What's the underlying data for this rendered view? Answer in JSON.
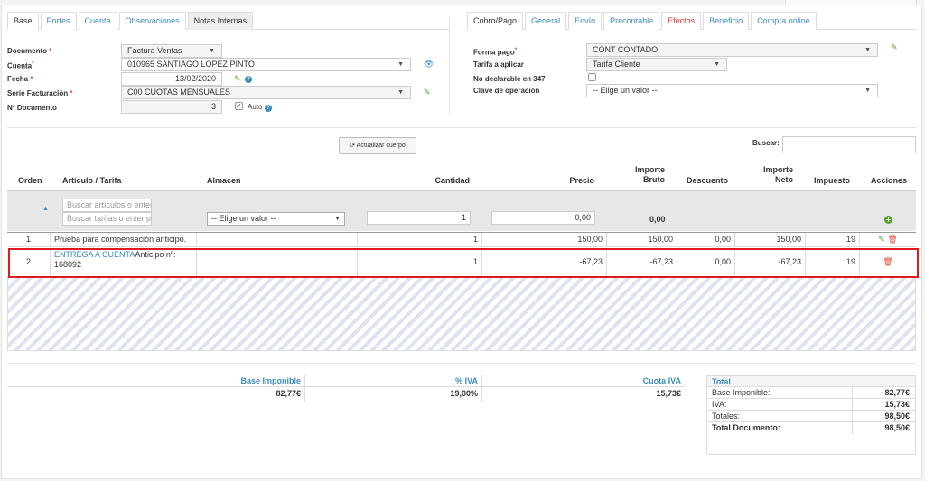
{
  "left_tabs": [
    "Base",
    "Portes",
    "Cuenta",
    "Observaciones",
    "Notas Internas"
  ],
  "right_tabs": [
    "Cobro/Pago",
    "General",
    "Envío",
    "Precontable",
    "Efectos",
    "Beneficio",
    "Compra online"
  ],
  "form_left": {
    "documento_label": "Documento",
    "documento_value": "Factura Ventas",
    "cuenta_label": "Cuenta",
    "cuenta_value": "010965 SANTIAGO LOPEZ PINTO",
    "fecha_label": "Fecha",
    "fecha_value": "13/02/2020",
    "serie_label": "Serie Facturación",
    "serie_value": "C00 CUOTAS MENSUALES",
    "ndoc_label": "Nº Documento",
    "ndoc_value": "3",
    "auto_label": "Auto"
  },
  "form_right": {
    "forma_pago_label": "Forma pago",
    "forma_pago_value": "CONT CONTADO",
    "tarifa_label": "Tarifa a aplicar",
    "tarifa_value": "Tarifa Cliente",
    "no_declarable_label": "No declarable en 347",
    "clave_label": "Clave de operación",
    "clave_value": "-- Elige un valor --"
  },
  "toolbar": {
    "actualizar_label": "Actualizar cuerpo",
    "buscar_label": "Buscar:"
  },
  "table": {
    "headers": {
      "orden": "Orden",
      "articulo": "Artículo / Tarifa",
      "almacen": "Almacen",
      "cantidad": "Cantidad",
      "precio": "Precio",
      "importe_bruto_1": "Importe",
      "importe_bruto_2": "Bruto",
      "descuento": "Descuento",
      "importe_neto_1": "Importe",
      "importe_neto_2": "Neto",
      "impuesto": "Impuesto",
      "acciones": "Acciones"
    },
    "filter": {
      "articulos_placeholder": "Buscar artículos o enter",
      "tarifas_placeholder": "Buscar tarifas o enter p",
      "almacen_value": "-- Elige un valor --",
      "cantidad_value": "1",
      "precio_value": "0,00",
      "bruto_value": "0,00"
    },
    "rows": [
      {
        "orden": "1",
        "articulo": "Prueba para compensación anticipo.",
        "cantidad": "1",
        "precio": "150,00",
        "bruto": "150,00",
        "descuento": "0,00",
        "neto": "150,00",
        "impuesto": "19"
      },
      {
        "orden": "2",
        "articulo_link": "ENTREGA A CUENTA",
        "articulo_text": "Anticipo nº:",
        "articulo_text2": "168092",
        "cantidad": "1",
        "precio": "-67,23",
        "bruto": "-67,23",
        "descuento": "0,00",
        "neto": "-67,23",
        "impuesto": "19"
      }
    ]
  },
  "totals": {
    "base_label": "Base Imponible",
    "iva_label": "% IVA",
    "cuota_label": "Cuota IVA",
    "base_value": "82,77€",
    "iva_value": "19,00%",
    "cuota_value": "15,73€"
  },
  "summary": {
    "title": "Total",
    "rows": [
      {
        "label": "Base Imponible:",
        "value": "82,77€"
      },
      {
        "label": "IVA:",
        "value": "15,73€"
      },
      {
        "label": "Totales:",
        "value": "98,50€"
      },
      {
        "label": "Total Documento:",
        "value": "98,50€"
      }
    ]
  },
  "colors": {
    "link": "#3c8dbc",
    "highlight": "#e0191c",
    "accent_green": "#5aa02c",
    "danger": "#dd4b39"
  }
}
